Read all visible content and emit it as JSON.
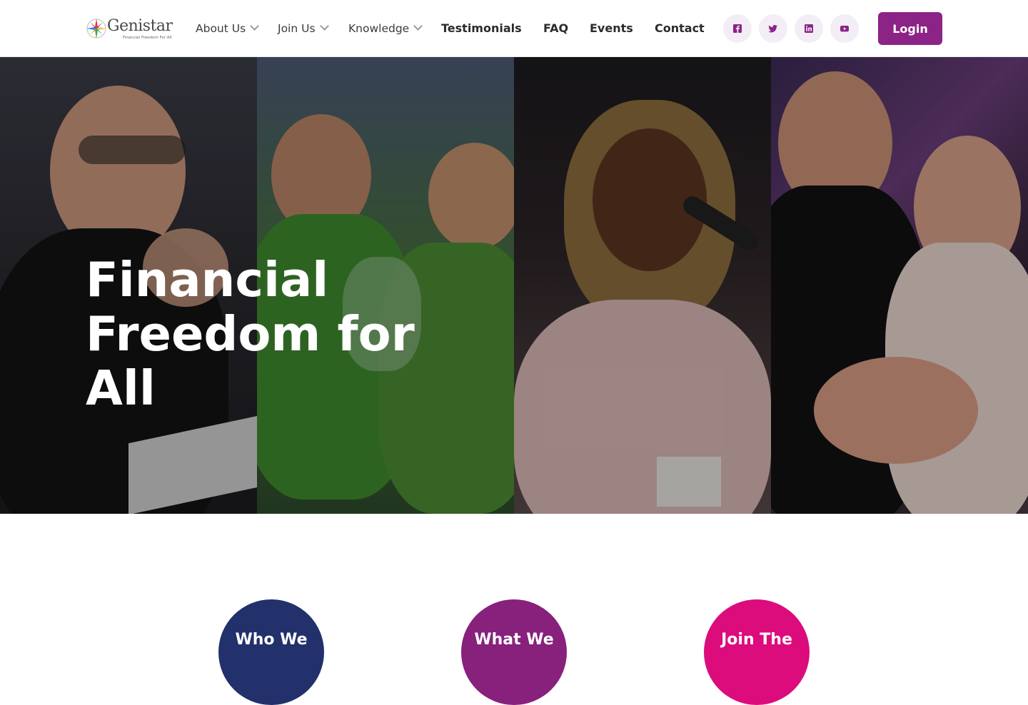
{
  "brand": {
    "name": "Genistar",
    "tagline": "Financial Freedom For All"
  },
  "nav": {
    "items": [
      {
        "label": "About Us",
        "dropdown": true
      },
      {
        "label": "Join Us",
        "dropdown": true
      },
      {
        "label": "Knowledge",
        "dropdown": true
      },
      {
        "label": "Testimonials",
        "dropdown": false
      },
      {
        "label": "FAQ",
        "dropdown": false
      },
      {
        "label": "Events",
        "dropdown": false
      },
      {
        "label": "Contact",
        "dropdown": false
      }
    ]
  },
  "social": [
    "facebook-icon",
    "twitter-icon",
    "linkedin-icon",
    "youtube-icon"
  ],
  "login_label": "Login",
  "hero": {
    "title": "Financial Freedom for All"
  },
  "circles": [
    {
      "label": "Who We",
      "color": "#22306b"
    },
    {
      "label": "What We",
      "color": "#87217c"
    },
    {
      "label": "Join The",
      "color": "#dc0c7c"
    }
  ],
  "colors": {
    "accent": "#8c2386",
    "social_bg": "#f3eef5"
  }
}
